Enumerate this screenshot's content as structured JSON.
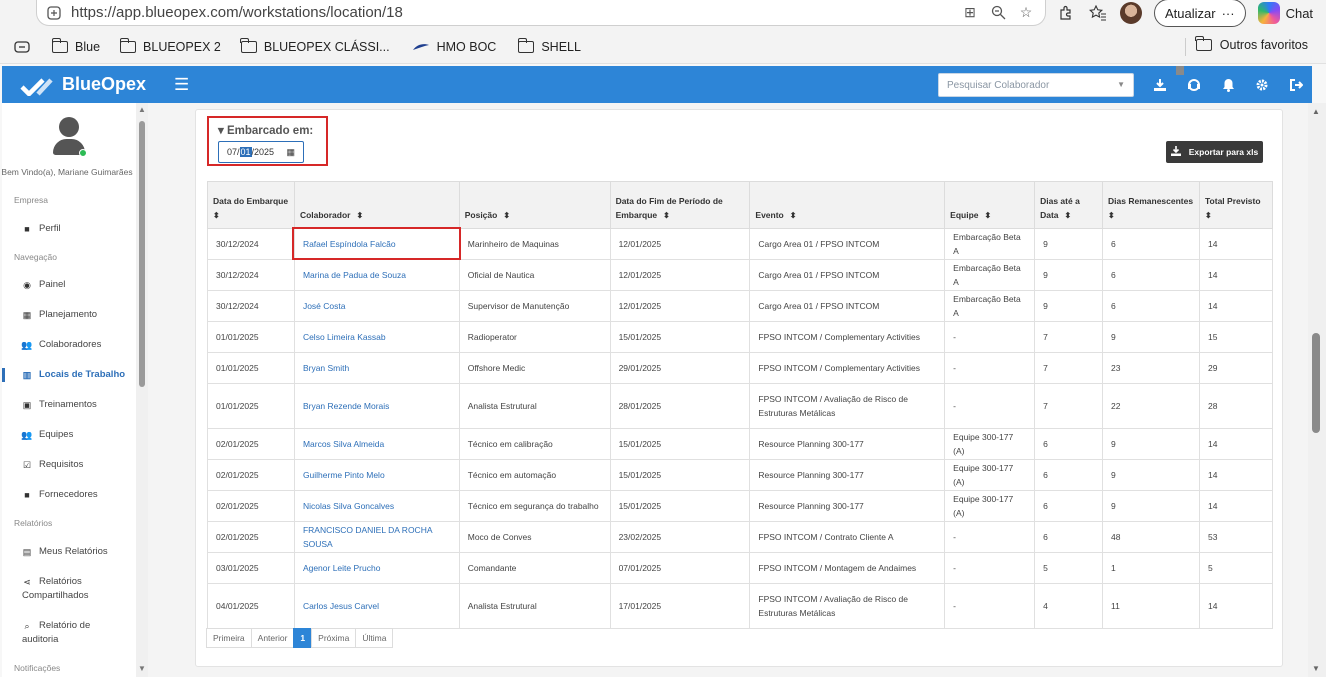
{
  "browser": {
    "url": "https://app.blueopex.com/workstations/location/18",
    "update_label": "Atualizar",
    "chat_label": "Chat",
    "favorites": [
      "Blue",
      "BLUEOPEX 2",
      "BLUEOPEX CLÁSSI...",
      "HMO BOC",
      "SHELL"
    ],
    "other_favorites": "Outros favoritos"
  },
  "header": {
    "brand": "BlueOpex",
    "search_placeholder": "Pesquisar Colaborador",
    "accent": "#2d85d7"
  },
  "sidebar": {
    "welcome": "Bem Vindo(a), Mariane Guimarães",
    "sections": {
      "empresa": "Empresa",
      "navegacao": "Navegação",
      "relatorios": "Relatórios",
      "notificacoes": "Notificações"
    },
    "items": {
      "perfil": "Perfil",
      "painel": "Painel",
      "planejamento": "Planejamento",
      "colaboradores": "Colaboradores",
      "locais": "Locais de Trabalho",
      "treinamentos": "Treinamentos",
      "equipes": "Equipes",
      "requisitos": "Requisitos",
      "fornecedores": "Fornecedores",
      "meus_relatorios": "Meus Relatórios",
      "relatorios_compartilhados_1": "Relatórios",
      "relatorios_compartilhados_2": "Compartilhados",
      "auditoria_1": "Relatório de",
      "auditoria_2": "auditoria"
    }
  },
  "filter": {
    "label": "▾ Embarcado em:",
    "date_day": "07/",
    "date_month": "01",
    "date_year": "/2025"
  },
  "export_label": "Exportar para xls",
  "table": {
    "headers": [
      "Data do Embarque",
      "Colaborador",
      "Posição",
      "Data do Fim de Período de Embarque",
      "Evento",
      "Equipe",
      "Dias até a Data",
      "Dias Remanescentes",
      "Total Previsto"
    ],
    "rows": [
      [
        "30/12/2024",
        "Rafael Espíndola Falcão",
        "Marinheiro de Maquinas",
        "12/01/2025",
        "Cargo Area 01 / FPSO INTCOM",
        "Embarcação Beta A",
        "9",
        "6",
        "14"
      ],
      [
        "30/12/2024",
        "Marina de Padua de Souza",
        "Oficial de Nautica",
        "12/01/2025",
        "Cargo Area 01 / FPSO INTCOM",
        "Embarcação Beta A",
        "9",
        "6",
        "14"
      ],
      [
        "30/12/2024",
        "José Costa",
        "Supervisor de Manutenção",
        "12/01/2025",
        "Cargo Area 01 / FPSO INTCOM",
        "Embarcação Beta A",
        "9",
        "6",
        "14"
      ],
      [
        "01/01/2025",
        "Celso Limeira Kassab",
        "Radioperator",
        "15/01/2025",
        "FPSO INTCOM / Complementary Activities",
        "-",
        "7",
        "9",
        "15"
      ],
      [
        "01/01/2025",
        "Bryan Smith",
        "Offshore Medic",
        "29/01/2025",
        "FPSO INTCOM / Complementary Activities",
        "-",
        "7",
        "23",
        "29"
      ],
      [
        "01/01/2025",
        "Bryan Rezende Morais",
        "Analista Estrutural",
        "28/01/2025",
        "FPSO INTCOM / Avaliação de Risco de Estruturas Metálicas",
        "-",
        "7",
        "22",
        "28"
      ],
      [
        "02/01/2025",
        "Marcos Silva Almeida",
        "Técnico em calibração",
        "15/01/2025",
        "Resource Planning 300-177",
        "Equipe 300-177 (A)",
        "6",
        "9",
        "14"
      ],
      [
        "02/01/2025",
        "Guilherme Pinto Melo",
        "Técnico em automação",
        "15/01/2025",
        "Resource Planning 300-177",
        "Equipe 300-177 (A)",
        "6",
        "9",
        "14"
      ],
      [
        "02/01/2025",
        "Nicolas Silva Goncalves",
        "Técnico em segurança do trabalho",
        "15/01/2025",
        "Resource Planning 300-177",
        "Equipe 300-177 (A)",
        "6",
        "9",
        "14"
      ],
      [
        "02/01/2025",
        "FRANCISCO DANIEL DA ROCHA SOUSA",
        "Moco de Conves",
        "23/02/2025",
        "FPSO INTCOM / Contrato Cliente A",
        "-",
        "6",
        "48",
        "53"
      ],
      [
        "03/01/2025",
        "Agenor Leite Prucho",
        "Comandante",
        "07/01/2025",
        "FPSO INTCOM / Montagem de Andaimes",
        "-",
        "5",
        "1",
        "5"
      ],
      [
        "04/01/2025",
        "Carlos Jesus Carvel",
        "Analista Estrutural",
        "17/01/2025",
        "FPSO INTCOM / Avaliação de Risco de Estruturas Metálicas",
        "-",
        "4",
        "11",
        "14"
      ]
    ]
  },
  "pagination": {
    "first": "Primeira",
    "prev": "Anterior",
    "current": "1",
    "next": "Próxima",
    "last": "Última"
  }
}
